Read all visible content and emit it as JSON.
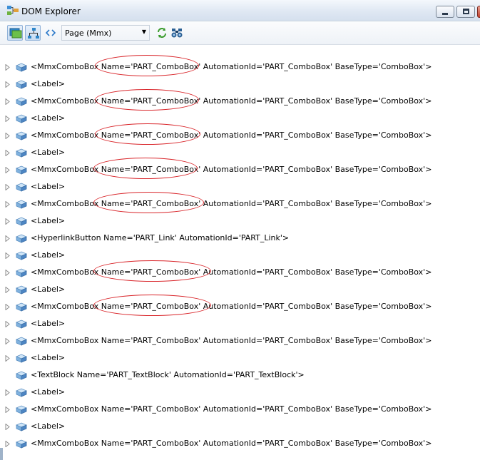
{
  "window": {
    "title": "DOM Explorer"
  },
  "toolbar": {
    "scope_select": {
      "value": "Page (Mmx)"
    }
  },
  "tree": {
    "rows": [
      {
        "text": "<MmxComboBox Name='PART_ComboBox' AutomationId='PART_ComboBox' BaseType='ComboBox'>",
        "expandable": true,
        "highlighted": true
      },
      {
        "text": "<Label>",
        "expandable": true,
        "highlighted": false
      },
      {
        "text": "<MmxComboBox Name='PART_ComboBox' AutomationId='PART_ComboBox' BaseType='ComboBox'>",
        "expandable": true,
        "highlighted": true
      },
      {
        "text": "<Label>",
        "expandable": true,
        "highlighted": false
      },
      {
        "text": "<MmxComboBox Name='PART_ComboBox' AutomationId='PART_ComboBox' BaseType='ComboBox'>",
        "expandable": true,
        "highlighted": true
      },
      {
        "text": "<Label>",
        "expandable": true,
        "highlighted": false
      },
      {
        "text": "<MmxComboBox Name='PART_ComboBox' AutomationId='PART_ComboBox' BaseType='ComboBox'>",
        "expandable": true,
        "highlighted": true
      },
      {
        "text": "<Label>",
        "expandable": true,
        "highlighted": false
      },
      {
        "text": "<MmxComboBox Name='PART_ComboBox' AutomationId='PART_ComboBox' BaseType='ComboBox'>",
        "expandable": true,
        "highlighted": true
      },
      {
        "text": "<Label>",
        "expandable": true,
        "highlighted": false
      },
      {
        "text": "<HyperlinkButton Name='PART_Link' AutomationId='PART_Link'>",
        "expandable": true,
        "highlighted": false
      },
      {
        "text": "<Label>",
        "expandable": true,
        "highlighted": false
      },
      {
        "text": "<MmxComboBox Name='PART_ComboBox' AutomationId='PART_ComboBox' BaseType='ComboBox'>",
        "expandable": true,
        "highlighted": true
      },
      {
        "text": "<Label>",
        "expandable": true,
        "highlighted": false
      },
      {
        "text": "<MmxComboBox Name='PART_ComboBox' AutomationId='PART_ComboBox' BaseType='ComboBox'>",
        "expandable": true,
        "highlighted": true
      },
      {
        "text": "<Label>",
        "expandable": true,
        "highlighted": false
      },
      {
        "text": "<MmxComboBox Name='PART_ComboBox' AutomationId='PART_ComboBox' BaseType='ComboBox'>",
        "expandable": true,
        "highlighted": false
      },
      {
        "text": "<Label>",
        "expandable": true,
        "highlighted": false
      },
      {
        "text": "<TextBlock Name='PART_TextBlock' AutomationId='PART_TextBlock'>",
        "expandable": false,
        "highlighted": false
      },
      {
        "text": "<Label>",
        "expandable": true,
        "highlighted": false
      },
      {
        "text": "<MmxComboBox Name='PART_ComboBox' AutomationId='PART_ComboBox' BaseType='ComboBox'>",
        "expandable": true,
        "highlighted": false
      },
      {
        "text": "<Label>",
        "expandable": true,
        "highlighted": false
      },
      {
        "text": "<MmxComboBox Name='PART_ComboBox' AutomationId='PART_ComboBox' BaseType='ComboBox'>",
        "expandable": true,
        "highlighted": false
      }
    ]
  },
  "icons": {
    "window": "dom-explorer-icon",
    "toolbar": [
      "layers-icon",
      "tree-view-icon",
      "code-brackets-icon",
      "refresh-icon",
      "binoculars-icon"
    ],
    "row": "node-icon",
    "expander": "expand-arrow-icon"
  },
  "colors": {
    "highlight": "#d9262b",
    "accent": "#2a78c9"
  }
}
